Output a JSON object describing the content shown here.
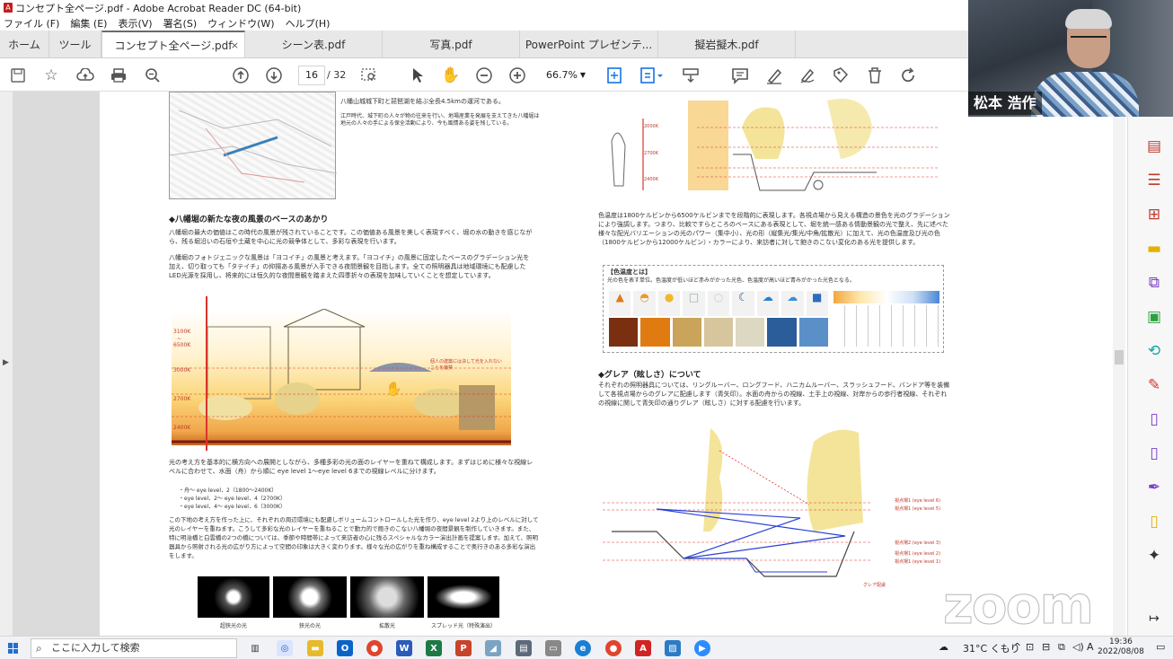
{
  "window": {
    "title": "コンセプト全ページ.pdf - Adobe Acrobat Reader DC (64-bit)"
  },
  "menu": [
    "ファイル (F)",
    "編集 (E)",
    "表示(V)",
    "署名(S)",
    "ウィンドウ(W)",
    "ヘルプ(H)"
  ],
  "tabs": {
    "home": "ホーム",
    "tools": "ツール",
    "docs": [
      "コンセプト全ページ.pdf",
      "シーン表.pdf",
      "写真.pdf",
      "PowerPoint プレゼンテ...",
      "擬岩擬木.pdf"
    ],
    "close": "×"
  },
  "toolbar": {
    "page": "16",
    "page_total": "/ 32",
    "zoom": "66.7%"
  },
  "participant": {
    "name": "松本 浩作"
  },
  "document": {
    "left_intro": "八幡山城城下町と琵琶湖を結ぶ全長4.5kmの運河である。",
    "left_intro_body": "江戸時代、城下町の人々が物の往来を行い、地場産業を発展を支えてきた八幡堀は地元の人々の手による保全活動により、今も風情ある姿を残している。",
    "heading1": "◆八幡堀の新たな夜の風景のベースのあかり",
    "para1": "八幡堀の最大の価値はこの時代の風景が残されていることです。この価値ある風景を美しく表現すべく、堀の水の動きを感じながら、残る堀沿いの石垣や土蔵を中心に光の競争体として、多彩な表現を行います。",
    "para2": "八幡堀のフォトジェニックな風景は「ヨコイチ」の風景と考えます。「ヨコイチ」の風景に固定したベースのグラデーション光を加え、切り取っても「タテイチ」の抑揚ある風景が入手できる夜間景観を目指します。全ての照明器具は地域環境にも配慮したLED光源を採用し、将来的には恒久的な夜間景観を踏まえた四季折々の表現を加味していくことを想定しています。",
    "chart_labels": [
      "3100K",
      "~",
      "6500K",
      "3000K",
      "2700K",
      "2400K"
    ],
    "chart_note": "個人の建築には決して光を入れないことを厳禁",
    "para3": "光の考え方を基本的に横方向への展開としながら、多種多彩の光の面のレイヤーを重ねて構成します。まずはじめに様々な視線レベルに合わせて、水面（舟）から順に eye level 1〜eye level 6までの視線レベルに分けます。",
    "levels": [
      "・舟〜 eye level．2（1800〜2400K）",
      "・eye level．2〜 eye level．4（2700K）",
      "・eye level．4〜 eye level．6（3000K）"
    ],
    "para4": "この下地の考え方を作った上に、それぞれの周辺環境にも配慮しボリュームコントロールした光を作り、eye level 2より上のレベルに対して光のレイヤーを重ねます。こうして多彩な光のレイヤーを重ねることで動力的で飽きのこない八幡堀の夜間景観を制作していきます。また、特に明治橋と白雲橋の2つの橋については、季節や時間帯によって来訪者の心に残るスペシャルなカラー演出計画を提案します。加えて、照明器具から照射される光の広がり方によって空間の印象は大きく変わります。様々な光の広がりを重ね構成することで奥行きのある多彩な演出をします。",
    "photo_captions": [
      "超狭光の光",
      "狭光の光",
      "拡散光",
      "スプレッド光（特殊演出）"
    ],
    "right_scale": [
      "2000K",
      "2700K",
      "2400K"
    ],
    "right_levels": [
      "視点場1 (eye level 6)",
      "視点場1 (eye level 5)",
      "視点場2 (eye level 3)",
      "視点場1 (eye level 2)",
      "視点場1 (eye level 1)"
    ],
    "right_para1": "色温度は1800ケルビンから6500ケルビンまでを段階的に表現します。各視点場から見える構造の景色を光のグラデーションにより強調します。つまり、比較ですらところのベースにある表現として、堀を統一感ある情動景観の光で整え、先に述べた様々な配光バリエーションの光のパワー（集中小）、光の形（縦集光/集光/中角/拡散光）に加えて、光の色温度及び光の色（1800ケルビンから12000ケルビン）・カラーにより、来訪者に対して飽きのこない変化のある光を提供します。",
    "ct_title": "【色温度とは】",
    "ct_body": "光の色を表す単位。色温度が低いほど赤みがかった光色、色温度が高いほど青みがかった光色となる。",
    "heading2": "◆グレア（眩しさ）について",
    "right_para2": "それぞれの照明器具については、リングルーバー、ロングフード、ハニカムルーバー、スラッシュフード、バンドア等を装備して各視点場からのグレアに配慮します（青矢印）。水面の舟からの視線、土手上の視線、対岸からの歩行者視線、それぞれの視線に関して青矢印の通りグレア（眩しさ）に対する配慮を行います。",
    "glare_label": "グレア配慮"
  },
  "taskbar": {
    "search_placeholder": "ここに入力して検索",
    "weather": "31°C くもり",
    "ime": "A",
    "time": "19:36",
    "date": "2022/08/08"
  },
  "watermark": "zoom"
}
